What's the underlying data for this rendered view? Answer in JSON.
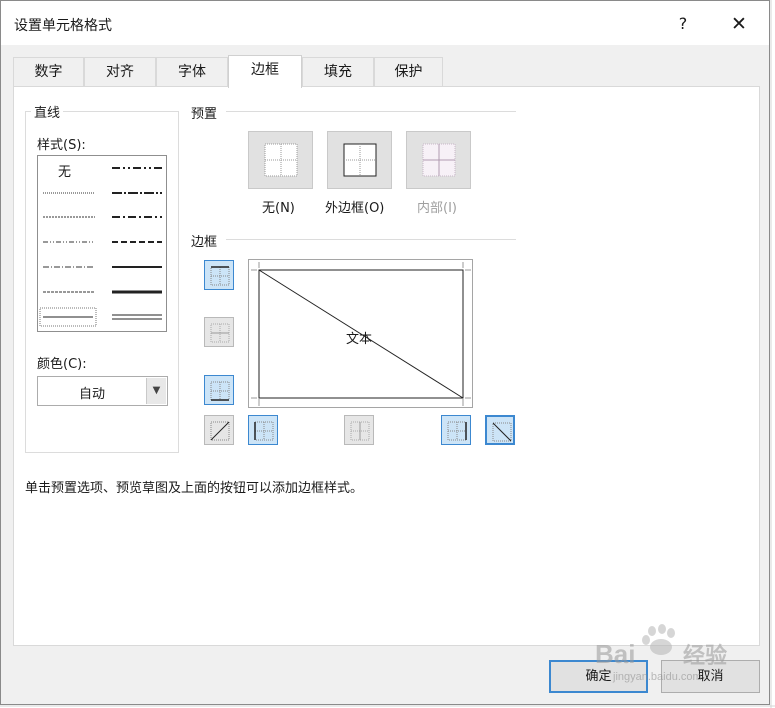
{
  "dialog": {
    "title": "设置单元格格式",
    "help_label": "?",
    "close_label": "✕"
  },
  "tabs": [
    {
      "label": "数字",
      "active": false
    },
    {
      "label": "对齐",
      "active": false
    },
    {
      "label": "字体",
      "active": false
    },
    {
      "label": "边框",
      "active": true
    },
    {
      "label": "填充",
      "active": false
    },
    {
      "label": "保护",
      "active": false
    }
  ],
  "line_group": {
    "title": "直线",
    "style_label": "样式(S):",
    "style_none": "无",
    "color_label": "颜色(C):",
    "color_value": "自动"
  },
  "presets": {
    "title": "预置",
    "items": [
      {
        "label": "无(N)",
        "enabled": true
      },
      {
        "label": "外边框(O)",
        "enabled": true
      },
      {
        "label": "内部(I)",
        "enabled": false
      }
    ]
  },
  "border": {
    "title": "边框",
    "preview_text": "文本"
  },
  "hint": "单击预置选项、预览草图及上面的按钮可以添加边框样式。",
  "buttons": {
    "ok": "确定",
    "cancel": "取消"
  },
  "watermark": {
    "brand": "Bai",
    "brand_suffix": "经验",
    "url": "jingyan.baidu.com"
  },
  "colors": {
    "accent": "#3c88d0",
    "toggle_on": "#cce4f7",
    "disabled_text": "#a0a0a0"
  }
}
